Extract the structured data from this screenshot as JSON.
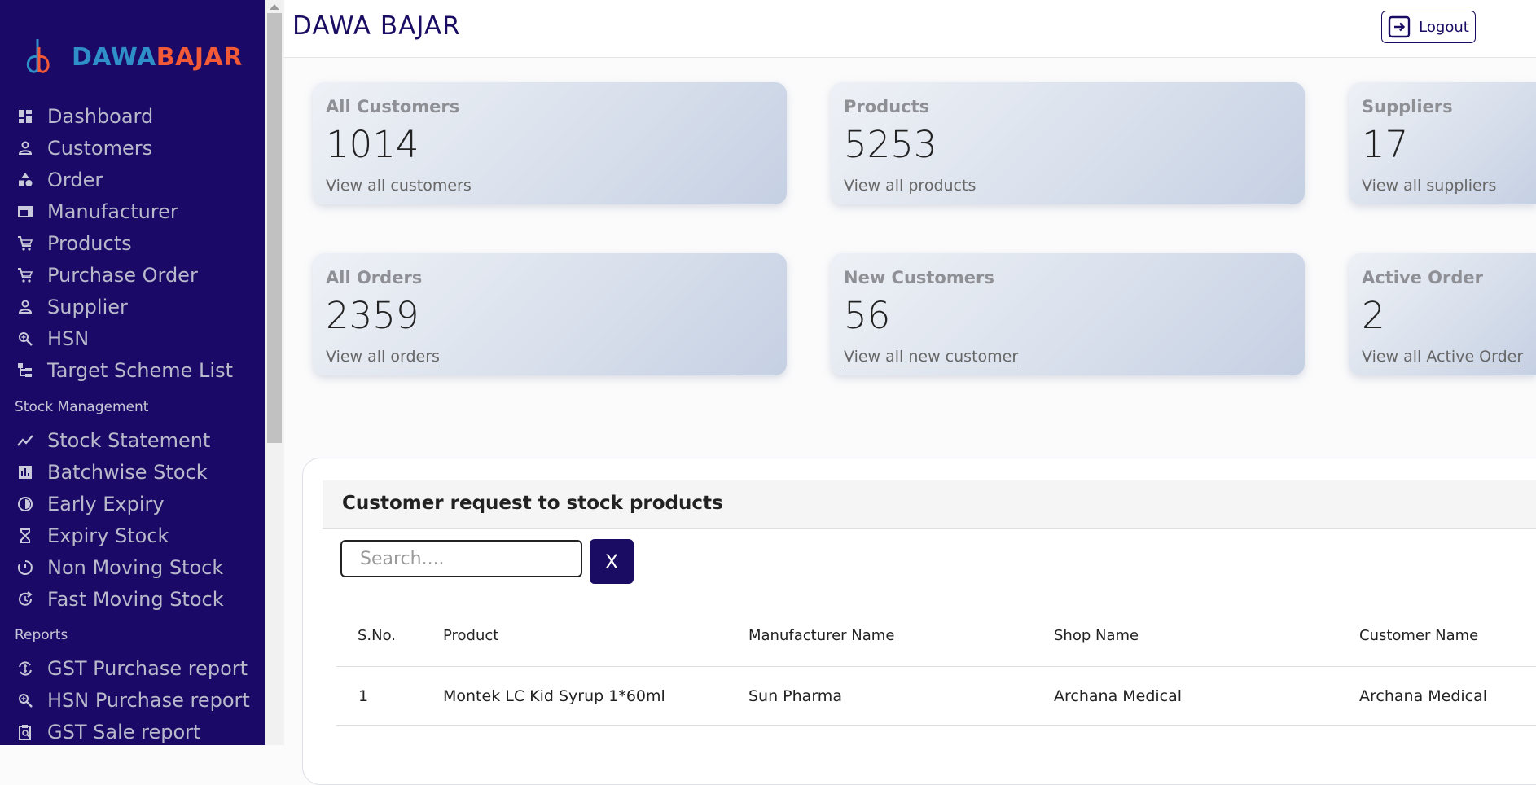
{
  "sidebar": {
    "logo": {
      "part1": "DAWA",
      "part2": "BAJAR"
    },
    "items": [
      {
        "label": "Dashboard",
        "icon": "dashboard-icon"
      },
      {
        "label": "Customers",
        "icon": "person-icon"
      },
      {
        "label": "Order",
        "icon": "shapes-icon"
      },
      {
        "label": "Manufacturer",
        "icon": "web-icon"
      },
      {
        "label": "Products",
        "icon": "cart-icon"
      },
      {
        "label": "Purchase Order",
        "icon": "cart-icon"
      },
      {
        "label": "Supplier",
        "icon": "person-icon"
      },
      {
        "label": "HSN",
        "icon": "zoom-icon"
      },
      {
        "label": "Target Scheme List",
        "icon": "tree-icon"
      }
    ],
    "stock_section": "Stock Management",
    "stock_items": [
      {
        "label": "Stock Statement",
        "icon": "trend-icon"
      },
      {
        "label": "Batchwise Stock",
        "icon": "bar-chart-icon"
      },
      {
        "label": "Early Expiry",
        "icon": "contrast-icon"
      },
      {
        "label": "Expiry Stock",
        "icon": "hourglass-icon"
      },
      {
        "label": "Non Moving Stock",
        "icon": "timer-icon"
      },
      {
        "label": "Fast Moving Stock",
        "icon": "refresh-icon"
      }
    ],
    "reports_section": "Reports",
    "report_items": [
      {
        "label": "GST Purchase report",
        "icon": "currency-exchange-icon"
      },
      {
        "label": "HSN Purchase report",
        "icon": "zoom-icon"
      },
      {
        "label": "GST Sale report",
        "icon": "clipboard-search-icon"
      }
    ]
  },
  "header": {
    "brand": "DAWA BAJAR",
    "logout_label": "Logout"
  },
  "stats": [
    {
      "title": "All Customers",
      "value": "1014",
      "link": "View all customers"
    },
    {
      "title": "Products",
      "value": "5253",
      "link": "View all products"
    },
    {
      "title": "Suppliers",
      "value": "17",
      "link": "View all suppliers"
    },
    {
      "title": "All Orders",
      "value": "2359",
      "link": "View all orders"
    },
    {
      "title": "New Customers",
      "value": "56",
      "link": "View all new customer"
    },
    {
      "title": "Active Order",
      "value": "2",
      "link": "View all Active Order"
    }
  ],
  "requests": {
    "title": "Customer request to stock products",
    "search_placeholder": "Search....",
    "clear_label": "X",
    "columns": [
      "S.No.",
      "Product",
      "Manufacturer Name",
      "Shop Name",
      "Customer Name"
    ],
    "rows": [
      [
        "1",
        "Montek LC Kid Syrup 1*60ml",
        "Sun Pharma",
        "Archana Medical",
        "Archana Medical"
      ]
    ]
  },
  "colors": {
    "sidebar_bg": "#1a0966",
    "accent": "#1b0c63",
    "logo_blue": "#2f8fc9",
    "logo_orange": "#f25a37"
  }
}
